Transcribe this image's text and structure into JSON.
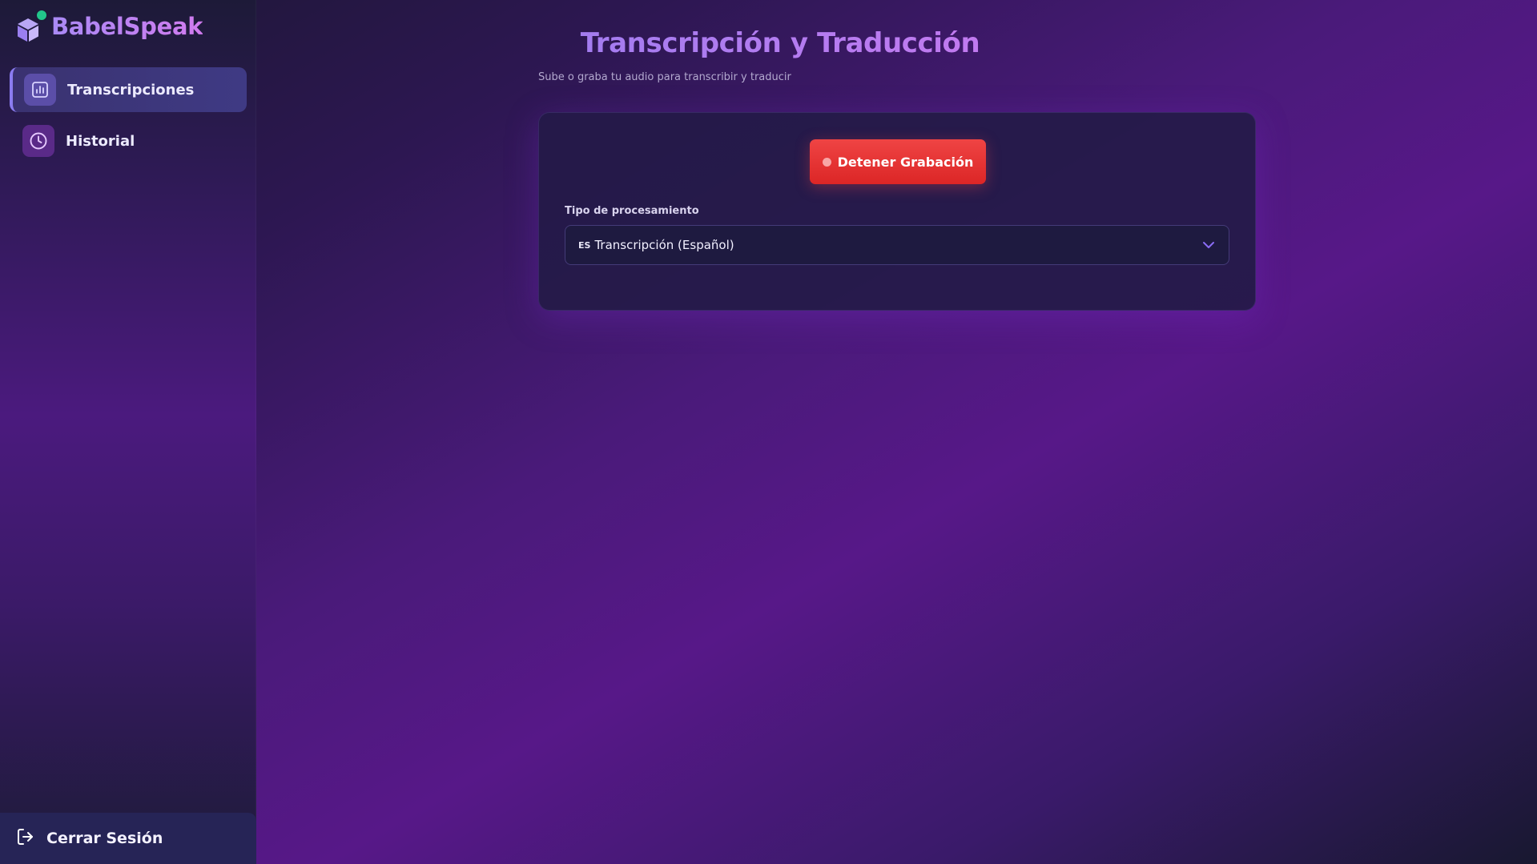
{
  "app": {
    "name": "BabelSpeak"
  },
  "sidebar": {
    "items": [
      {
        "label": "Transcripciones",
        "icon": "chart-icon",
        "active": true
      },
      {
        "label": "Historial",
        "icon": "clock-icon",
        "active": false
      }
    ],
    "logout_label": "Cerrar Sesión"
  },
  "main": {
    "title": "Transcripción y Traducción",
    "subtitle": "Sube o graba tu audio para transcribir y traducir",
    "record_button": "Detener Grabación",
    "processing": {
      "label": "Tipo de procesamiento",
      "selected_flag": "ES",
      "selected_value": "Transcripción (Español)"
    }
  },
  "colors": {
    "accent": "#8b7cf0",
    "record": "#ef4444",
    "status_dot": "#22c58b"
  }
}
